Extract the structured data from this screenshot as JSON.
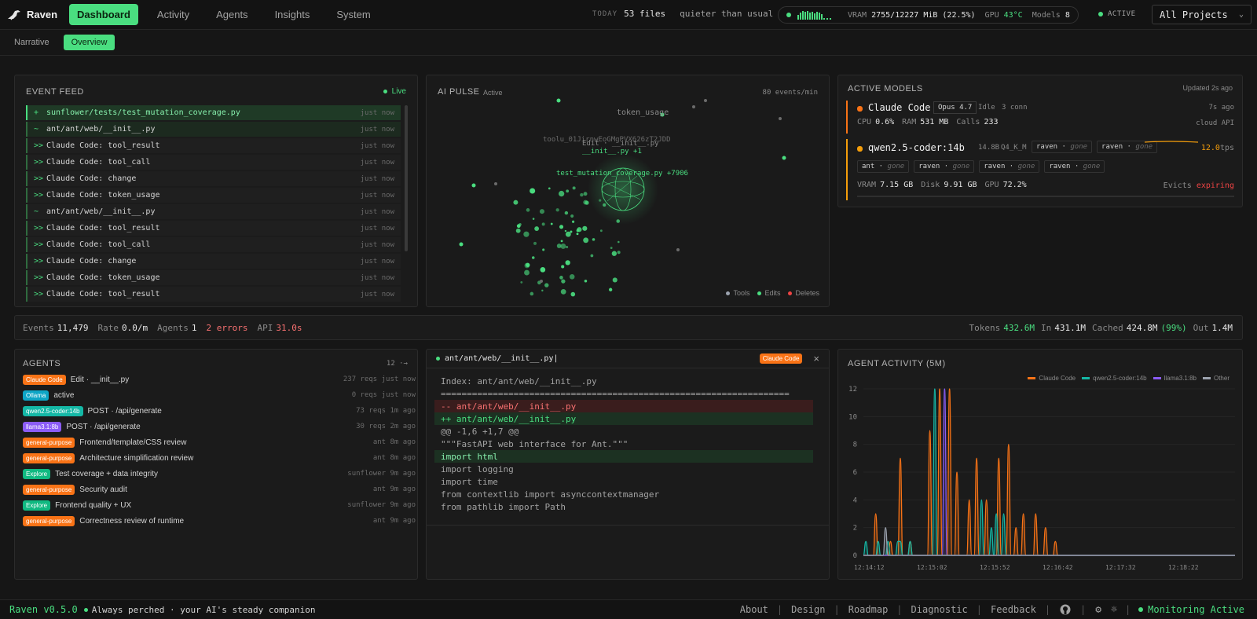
{
  "app": {
    "name": "Raven"
  },
  "nav": {
    "tabs": [
      "Dashboard",
      "Activity",
      "Agents",
      "Insights",
      "System"
    ]
  },
  "topstats": {
    "today_label": "TODAY",
    "files": "53 files",
    "quiet": "quieter than usual"
  },
  "system": {
    "vram_label": "VRAM",
    "vram_value": "2755/12227 MiB (22.5%)",
    "gpu_label": "GPU",
    "gpu_value": "43°C",
    "models_label": "Models",
    "models_value": "8",
    "status": "ACTIVE"
  },
  "project_select": {
    "value": "All Projects"
  },
  "subnav": {
    "tabs": [
      "Narrative",
      "Overview"
    ]
  },
  "event_feed": {
    "title": "EVENT FEED",
    "live": "Live",
    "rows": [
      {
        "icon": "+",
        "text": "sunflower/tests/test_mutation_coverage.py",
        "time": "just now"
      },
      {
        "icon": "~",
        "text": "ant/ant/web/__init__.py",
        "time": "just now"
      },
      {
        "icon": ">>",
        "text": "Claude Code: tool_result",
        "time": "just now"
      },
      {
        "icon": ">>",
        "text": "Claude Code: tool_call",
        "time": "just now"
      },
      {
        "icon": ">>",
        "text": "Claude Code: change",
        "time": "just now"
      },
      {
        "icon": ">>",
        "text": "Claude Code: token_usage",
        "time": "just now"
      },
      {
        "icon": "~",
        "text": "ant/ant/web/__init__.py",
        "time": "just now"
      },
      {
        "icon": ">>",
        "text": "Claude Code: tool_result",
        "time": "just now"
      },
      {
        "icon": ">>",
        "text": "Claude Code: tool_call",
        "time": "just now"
      },
      {
        "icon": ">>",
        "text": "Claude Code: change",
        "time": "just now"
      },
      {
        "icon": ">>",
        "text": "Claude Code: token_usage",
        "time": "just now"
      },
      {
        "icon": ">>",
        "text": "Claude Code: tool_result",
        "time": "just now"
      }
    ]
  },
  "ai_pulse": {
    "title": "AI PULSE",
    "state": "Active",
    "rate": "80 events/min",
    "labels": {
      "token": "token_usage",
      "tool": "toolu_01JirnwEoGMgPVX626zT2JDD",
      "edit": "Edit · __init__.py",
      "init": "__init__.py +1",
      "test": "test_mutation_coverage.py +7906"
    },
    "legend": [
      "Tools",
      "Edits",
      "Deletes"
    ]
  },
  "active_models": {
    "title": "ACTIVE MODELS",
    "updated": "Updated 2s ago",
    "claude": {
      "name": "Claude Code",
      "model": "Opus 4.7",
      "state": "Idle",
      "conn": "3 conn",
      "ago": "7s ago",
      "cpu_label": "CPU",
      "cpu": "0.6%",
      "ram_label": "RAM",
      "ram": "531 MB",
      "calls_label": "Calls",
      "calls": "233",
      "kind": "cloud API"
    },
    "qwen": {
      "name": "qwen2.5-coder:14b",
      "size": "14.8B",
      "quant": "Q4_K_M",
      "tps": "12.0",
      "tps_unit": "tps",
      "chips": [
        {
          "name": "raven",
          "state": "gone"
        },
        {
          "name": "raven",
          "state": "gone"
        },
        {
          "name": "ant",
          "state": "gone"
        },
        {
          "name": "raven",
          "state": "gone"
        },
        {
          "name": "raven",
          "state": "gone"
        },
        {
          "name": "raven",
          "state": "gone"
        }
      ],
      "vram_label": "VRAM",
      "vram": "7.15 GB",
      "disk_label": "Disk",
      "disk": "9.91 GB",
      "gpu_label": "GPU",
      "gpu": "72.2%",
      "evicts_label": "Evicts",
      "evicts": "expiring"
    }
  },
  "stats": {
    "events_label": "Events",
    "events": "11,479",
    "rate_label": "Rate",
    "rate": "0.0/m",
    "agents_label": "Agents",
    "agents": "1",
    "errors": "2 errors",
    "api_label": "API",
    "api": "31.0s",
    "tokens_label": "Tokens",
    "tokens": "432.6M",
    "in_label": "In",
    "in": "431.1M",
    "cached_label": "Cached",
    "cached": "424.8M",
    "cached_pct": "(99%)",
    "out_label": "Out",
    "out": "1.4M"
  },
  "agents": {
    "title": "AGENTS",
    "count": "12 ·→",
    "rows": [
      {
        "badge": "Claude Code",
        "color": "#f97316",
        "desc": "Edit · __init__.py",
        "meta": "237 reqs  just now"
      },
      {
        "badge": "Ollama",
        "color": "#0ea5c6",
        "desc": "active",
        "meta": "0 reqs  just now"
      },
      {
        "badge": "qwen2.5-coder:14b",
        "color": "#14b8a6",
        "desc": "POST · /api/generate",
        "meta": "73 reqs  1m ago"
      },
      {
        "badge": "llama3.1:8b",
        "color": "#8b5cf6",
        "desc": "POST · /api/generate",
        "meta": "30 reqs  2m ago"
      },
      {
        "badge": "general-purpose",
        "color": "#f97316",
        "desc": "Frontend/template/CSS review",
        "meta": "ant  8m ago"
      },
      {
        "badge": "general-purpose",
        "color": "#f97316",
        "desc": "Architecture simplification review",
        "meta": "ant  8m ago"
      },
      {
        "badge": "Explore",
        "color": "#10b981",
        "desc": "Test coverage + data integrity",
        "meta": "sunflower  9m ago"
      },
      {
        "badge": "general-purpose",
        "color": "#f97316",
        "desc": "Security audit",
        "meta": "ant  9m ago"
      },
      {
        "badge": "Explore",
        "color": "#10b981",
        "desc": "Frontend quality + UX",
        "meta": "sunflower  9m ago"
      },
      {
        "badge": "general-purpose",
        "color": "#f97316",
        "desc": "Correctness review of runtime",
        "meta": "ant  9m ago"
      }
    ]
  },
  "diff": {
    "file": "ant/ant/web/__init__.py|",
    "tag": "Claude Code",
    "close": "×",
    "lines": [
      {
        "t": "Index: ant/ant/web/__init__.py",
        "k": "meta"
      },
      {
        "t": "===================================================================",
        "k": "meta"
      },
      {
        "t": "-- ant/ant/web/__init__.py",
        "k": "del"
      },
      {
        "t": "++ ant/ant/web/__init__.py",
        "k": "add"
      },
      {
        "t": "@@ -1,6 +1,7 @@",
        "k": "meta"
      },
      {
        "t": "\"\"\"FastAPI web interface for Ant.\"\"\"",
        "k": "ctx"
      },
      {
        "t": "import html",
        "k": "addline"
      },
      {
        "t": "import logging",
        "k": "ctx"
      },
      {
        "t": "import time",
        "k": "ctx"
      },
      {
        "t": "from contextlib import asynccontextmanager",
        "k": "ctx"
      },
      {
        "t": "from pathlib import Path",
        "k": "ctx"
      }
    ]
  },
  "chart_data": {
    "type": "area",
    "title": "AGENT ACTIVITY (5M)",
    "x_ticks": [
      "12:14:12",
      "12:15:02",
      "12:15:52",
      "12:16:42",
      "12:17:32",
      "12:18:22"
    ],
    "y_ticks": [
      "0",
      "2",
      "4",
      "6",
      "8",
      "10",
      "12"
    ],
    "ylim": [
      0,
      12
    ],
    "legend": "top-right",
    "series": [
      {
        "name": "Claude Code",
        "color": "#f97316",
        "values": [
          0,
          0,
          0,
          0,
          0,
          3,
          0,
          0,
          0,
          0,
          0,
          1,
          0,
          0,
          0,
          7,
          0,
          0,
          0,
          1,
          0,
          0,
          0,
          0,
          0,
          0,
          0,
          9,
          0,
          0,
          0,
          12,
          0,
          0,
          0,
          12,
          0,
          0,
          6,
          0,
          0,
          0,
          0,
          4,
          0,
          0,
          7,
          0,
          0,
          0,
          4,
          0,
          0,
          0,
          0,
          7,
          0,
          0,
          0,
          8,
          0,
          0,
          2,
          0,
          0,
          3,
          0,
          0,
          0,
          0,
          3,
          0,
          0,
          0,
          2,
          0,
          0,
          0,
          1,
          0,
          0,
          0,
          0,
          0,
          0,
          0,
          0,
          0,
          0,
          0,
          0,
          0,
          0,
          0,
          0,
          0,
          0,
          0,
          0,
          0,
          0,
          0,
          0,
          0,
          0,
          0,
          0,
          0,
          0,
          0,
          0,
          0,
          0,
          0,
          0,
          0,
          0,
          0,
          0,
          0,
          0,
          0,
          0,
          0,
          0,
          0,
          0,
          0,
          0,
          0,
          0,
          0,
          0,
          0,
          0,
          0,
          0,
          0,
          0,
          0,
          0,
          0,
          0,
          0,
          0,
          0,
          0,
          0,
          0,
          0,
          0,
          0
        ]
      },
      {
        "name": "qwen2.5-coder:14b",
        "color": "#14b8a6",
        "values": [
          0,
          1,
          0,
          0,
          0,
          0,
          1,
          0,
          0,
          0,
          1,
          0,
          0,
          0,
          1,
          1,
          0,
          0,
          0,
          1,
          0,
          0,
          0,
          0,
          0,
          0,
          0,
          0,
          0,
          12,
          0,
          0,
          0,
          0,
          0,
          0,
          0,
          0,
          0,
          0,
          0,
          0,
          0,
          0,
          0,
          0,
          0,
          0,
          4,
          0,
          0,
          0,
          2,
          0,
          3,
          0,
          0,
          3,
          0,
          0,
          0,
          0,
          0,
          0,
          0,
          0,
          0,
          0,
          0,
          0,
          0,
          0,
          0,
          0,
          0,
          0,
          0,
          0,
          0,
          0,
          0,
          0,
          0,
          0,
          0,
          0,
          0,
          0,
          0,
          0,
          0,
          0,
          0,
          0,
          0,
          0,
          0,
          0,
          0,
          0,
          0,
          0,
          0,
          0,
          0,
          0,
          0,
          0,
          0,
          0,
          0,
          0,
          0,
          0,
          0,
          0,
          0,
          0,
          0,
          0,
          0,
          0,
          0,
          0,
          0,
          0,
          0,
          0,
          0,
          0,
          0,
          0,
          0,
          0,
          0,
          0,
          0,
          0,
          0,
          0,
          0,
          0,
          0,
          0,
          0,
          0,
          0,
          0,
          0,
          0,
          0,
          0,
          0
        ]
      },
      {
        "name": "llama3.1:8b",
        "color": "#8b5cf6",
        "values": [
          0,
          0,
          0,
          0,
          0,
          0,
          0,
          0,
          0,
          0,
          0,
          0,
          0,
          0,
          0,
          0,
          0,
          0,
          0,
          0,
          0,
          0,
          0,
          0,
          0,
          0,
          0,
          0,
          0,
          0,
          0,
          0,
          0,
          12,
          0,
          0,
          0,
          0,
          0,
          0,
          0,
          0,
          0,
          0,
          0,
          0,
          0,
          0,
          0,
          0,
          0,
          0,
          0,
          0,
          0,
          0,
          0,
          0,
          0,
          0,
          0,
          0,
          0,
          0,
          0,
          0,
          0,
          0,
          0,
          0,
          0,
          0,
          0,
          0,
          0,
          0,
          0,
          0,
          0,
          0,
          0,
          0,
          0,
          0,
          0,
          0,
          0,
          0,
          0,
          0,
          0,
          0,
          0,
          0,
          0,
          0,
          0,
          0,
          0,
          0,
          0,
          0,
          0,
          0,
          0,
          0,
          0,
          0,
          0,
          0,
          0,
          0,
          0,
          0,
          0,
          0,
          0,
          0,
          0,
          0,
          0,
          0,
          0,
          0,
          0,
          0,
          0,
          0,
          0,
          0,
          0,
          0,
          0,
          0,
          0,
          0,
          0,
          0,
          0,
          0,
          0,
          0,
          0,
          0,
          0,
          0,
          0,
          0,
          0,
          0,
          0,
          0,
          0
        ]
      },
      {
        "name": "Other",
        "color": "#9ca3af",
        "values": [
          0,
          0,
          0,
          0,
          0,
          0,
          0,
          0,
          0,
          2,
          0,
          0,
          0,
          0,
          0,
          0,
          0,
          0,
          0,
          0,
          0,
          0,
          0,
          0,
          0,
          0,
          0,
          0,
          0,
          0,
          0,
          0,
          0,
          0,
          0,
          0,
          0,
          0,
          0,
          0,
          0,
          0,
          0,
          0,
          0,
          0,
          0,
          0,
          0,
          0,
          0,
          0,
          0,
          0,
          0,
          0,
          0,
          0,
          0,
          0,
          0,
          0,
          0,
          0,
          0,
          0,
          0,
          0,
          0,
          0,
          0,
          0,
          0,
          0,
          0,
          0,
          0,
          0,
          0,
          0,
          0,
          0,
          0,
          0,
          0,
          0,
          0,
          0,
          0,
          0,
          0,
          0,
          0,
          0,
          0,
          0,
          0,
          0,
          0,
          0,
          0,
          0,
          0,
          0,
          0,
          0,
          0,
          0,
          0,
          0,
          0,
          0,
          0,
          0,
          0,
          0,
          0,
          0,
          0,
          0,
          0,
          0,
          0,
          0,
          0,
          0,
          0,
          0,
          0,
          0,
          0,
          0,
          0,
          0,
          0,
          0,
          0,
          0,
          0,
          0,
          0,
          0,
          0,
          0,
          0,
          0,
          0,
          0,
          0,
          0,
          0,
          0,
          0
        ]
      }
    ]
  },
  "footer": {
    "version": "Raven v0.5.0",
    "tagline": "Always perched · your AI's steady companion",
    "links": [
      "About",
      "Design",
      "Roadmap",
      "Diagnostic",
      "Feedback"
    ],
    "status": "Monitoring Active"
  }
}
